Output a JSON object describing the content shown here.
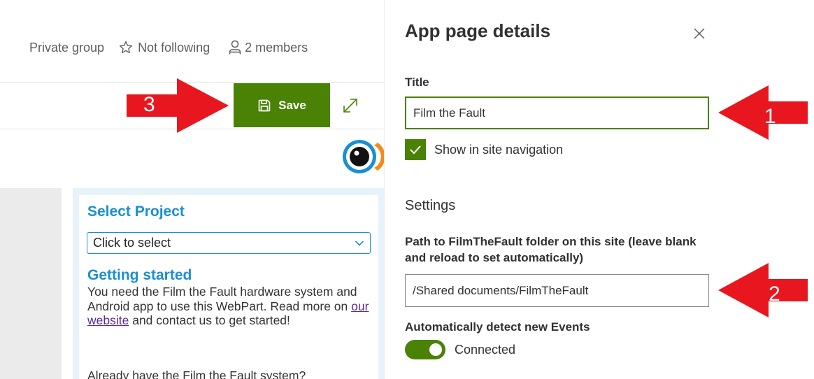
{
  "group": {
    "privacy": "Private group",
    "follow": "Not following",
    "members": "2 members"
  },
  "toolbar": {
    "save_label": "Save"
  },
  "webpart": {
    "title": "Select Project",
    "select_value": "Click to select",
    "getting_started_heading": "Getting started",
    "body_before_link": "You need the Film the Fault hardware system and Android app to use this WebPart. Read more on ",
    "link_text": "our website",
    "body_after_link": " and contact us to get started!",
    "body2": "Already have the Film the Fault system?"
  },
  "panel": {
    "title": "App page details",
    "title_label": "Title",
    "title_value": "Film the Fault",
    "show_in_nav_label": "Show in site navigation",
    "show_in_nav_checked": true,
    "settings_heading": "Settings",
    "path_label": "Path to FilmTheFault folder on this site (leave blank and reload to set automatically)",
    "path_value": "/Shared documents/FilmTheFault",
    "auto_detect_label": "Automatically detect new Events",
    "toggle_state_label": "Connected",
    "toggle_on": true
  },
  "annotations": {
    "arrow1": "1",
    "arrow2": "2",
    "arrow3": "3"
  },
  "colors": {
    "accent_green": "#498205",
    "webpart_blue": "#1a8fd3",
    "annotation_red": "#e8171f"
  }
}
